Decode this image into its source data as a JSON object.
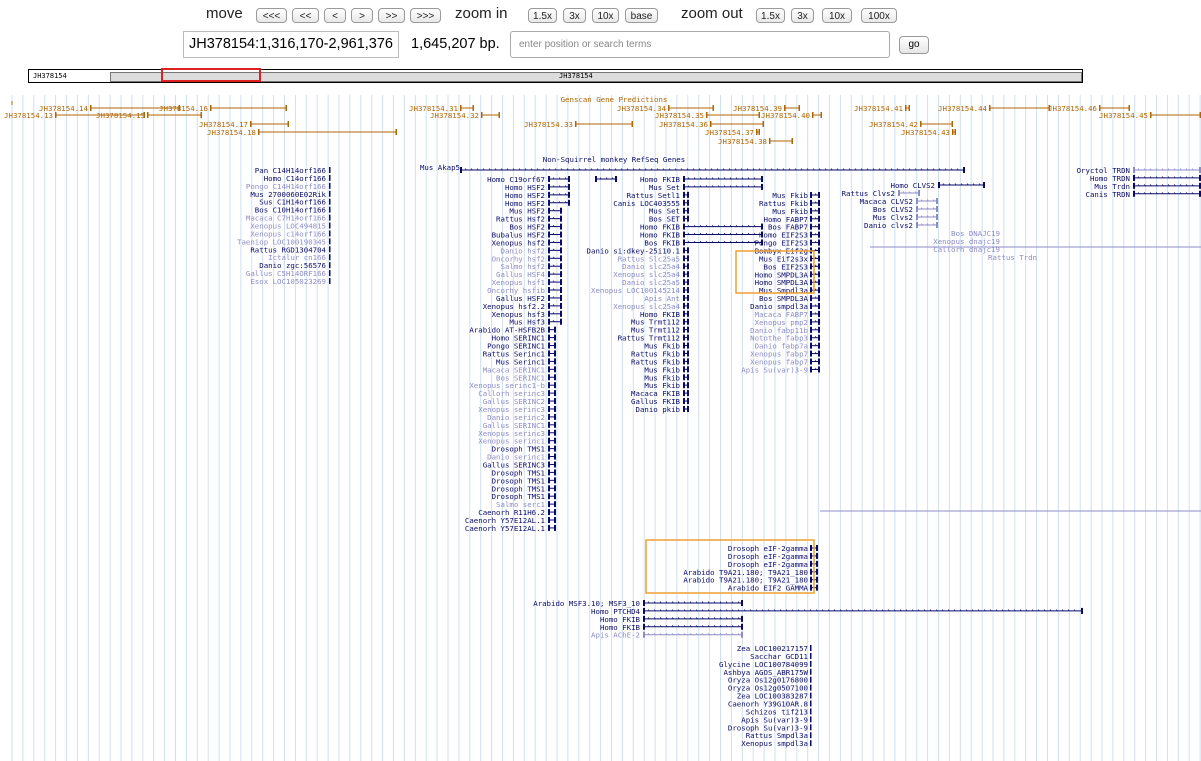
{
  "nav": {
    "move_label": "move",
    "move_buttons": [
      "<<<",
      "<<",
      "<",
      ">",
      ">>",
      ">>>"
    ],
    "zoom_in_label": "zoom in",
    "zoom_in_buttons": [
      "1.5x",
      "3x",
      "10x",
      "base"
    ],
    "zoom_out_label": "zoom out",
    "zoom_out_buttons": [
      "1.5x",
      "3x",
      "10x",
      "100x"
    ]
  },
  "position": {
    "value": "JH378154:1,316,170-2,961,376",
    "size": "1,645,207 bp.",
    "search_placeholder": "enter position or search terms",
    "go_label": "go"
  },
  "ideogram": {
    "chrom": "JH378154",
    "center_label": "JH378154"
  },
  "colors": {
    "contig": "#b26400",
    "gene": "#0a0a6a",
    "faded": "#8c8cc8",
    "grid": "#cfe0f2",
    "highlight": "#f0a030"
  },
  "tracks": {
    "contig_labels": [
      "JH378154.14",
      "JH378154.13",
      "JH378154.16",
      "JH378154.15",
      "JH378154.17",
      "JH378154.18",
      "JH378154.31",
      "JH378154.32",
      "JH378154.33",
      "JH378154.34",
      "JH378154.35",
      "JH378154.39",
      "JH378154.40",
      "JH378154.36",
      "JH378154.37",
      "JH378154.38",
      "JH378154.41",
      "JH378154.44",
      "JH378154.42",
      "JH378154.43",
      "JH378154.46",
      "JH378154.45"
    ],
    "genscan_title": "Genscan Gene Predictions",
    "refseq_title": "Non-Squirrel monkey RefSeq Genes",
    "left_genes": [
      "Pan C14H14orf166",
      "Homo C14orf166",
      "Pongo C14H14orf166",
      "Mus 2700060E02Rik",
      "Sus C1H14orf166",
      "Bos C10H14orf166",
      "Macaca C7H14orf166",
      "Xenopus LOC494815",
      "Xenopus c14orf166",
      "Taeniop LOC100190345",
      "Rattus RGD1304704",
      "Ictalur cn166",
      "Danio zgc:56576",
      "Gallus C5H14ORF166",
      "Esox LOC105023269"
    ],
    "center_genes": [
      "Homo C19orf67",
      "Homo HSF2",
      "Homo HSF2",
      "Homo HSF2",
      "Mus HSF2",
      "Rattus Hsf2",
      "Bos HSF2",
      "Bubalus HSF2",
      "Xenopus hsf2",
      "Danio hsf2",
      "Oncorhy hsf2",
      "Salmo hsf2",
      "Gallus HSF4",
      "Xenopus hsf1",
      "Oncorhy hsfib",
      "Gallus HSF2",
      "Xenopus hsf2.2",
      "Xenopus hsf3",
      "Mus Hsf3",
      "Arabido AT-HSFB2B",
      "Homo SERINC1",
      "Pongo SERINC1",
      "Rattus Serinc1",
      "Mus Serinc1",
      "Macaca SERINC1",
      "Bos SERINC1",
      "Xenopus serinc1-b",
      "Callorh serinc3",
      "Gallus SERINC2",
      "Xenopus serinc3",
      "Danio serinc2",
      "Gallus SERINC1",
      "Xenopus serinc3",
      "Xenopus serinc1",
      "Drosoph TMS1",
      "Danio serinc1",
      "Gallus SERINC3",
      "Drosoph TMS1",
      "Drosoph TMS1",
      "Drosoph TMS1",
      "Drosoph TMS1",
      "Salmo serc1",
      "Caenorh R11H6.2",
      "Caenorh Y57E12AL.1",
      "Caenorh Y57E12AL.1"
    ],
    "right_labels_a": [
      "Homo FKIB",
      "Mus Set",
      "Rattus Setl1",
      "Canis LOC403555",
      "Mus Set",
      "Bos SET",
      "Homo FKIB",
      "Homo FKIB",
      "Bos FKIB",
      "Danio si:dkey-25i10.1",
      "Rattus Slc25a5",
      "Danio slc25a4",
      "Xenopus slc25a4",
      "Danio slc25a5",
      "Xenopus LOC100145214",
      "Apis Ant",
      "Xenopus slc25a4",
      "Homo FKIB",
      "Mus Trmt112",
      "Mus Trmt112",
      "Rattus Trmt112",
      "Mus Fkib",
      "Rattus Fkib",
      "Rattus Fkib",
      "Mus Fkib",
      "Mus Fkib",
      "Mus Fkib",
      "Macaca FKIB",
      "Gallus FKIB",
      "Danio pkib"
    ],
    "right_labels_b": [
      "Mus Fkib",
      "Rattus Fkib",
      "Mus Fkib",
      "Homo FABP7",
      "Bos FABP7",
      "Homo EIF2S3",
      "Pongo EIF2S3",
      "Bombyx Eif2g",
      "Mus Eif2s3x",
      "Bos EIF2S3",
      "Homo SMPDL3A",
      "Homo SMPDL3A",
      "Mus Smpdl3a",
      "Bos SMPDL3A",
      "Danio smpdl3a",
      "Macaca FABP7",
      "Xenopus pmp2",
      "Danio fabp11b",
      "Notothe fabp3",
      "Danio fabp7a",
      "Xenopus fabp7",
      "Xenopus fabp7",
      "Apis Su(var)3-9"
    ],
    "orange_box_genes": [
      "Drosoph eIF-2gamma",
      "Drosoph eIF-2gamma",
      "Drosoph eIF-2gamma",
      "Arabido T9A21.180; T9A21_180",
      "Arabido T9A21.180; T9A21_180",
      "Arabido EIF2 GAMMA"
    ],
    "mid_lower": [
      "Arabido MSF3.10; MSF3_10",
      "Homo PTCHD4",
      "Homo FKIB",
      "Homo FKIB",
      "Apis AChE-2"
    ],
    "bottom_genes": [
      "Zea LOC100217157",
      "Sacchar GCD11",
      "Glycine LOC100784099",
      "Ashbya AGOS_ABR175W",
      "Oryza Os12g0176800",
      "Oryza Os12g0507100",
      "Zea LOC100383287",
      "Caenorh Y39G10AR.8",
      "Schizos tif213",
      "Apis Su(var)3-9",
      "Drosoph Su(var)3-9",
      "Rattus Smpdl3a",
      "Xenopus smpdl3a"
    ],
    "far_right_a": [
      "Mus Akap5",
      "Homo CLVS2",
      "Rattus Clvs2",
      "Macaca CLVS2",
      "Bos CLVS2",
      "Mus Clvs2",
      "Danio clvs2",
      "Bos DNAJC19",
      "Xenopus dnajc19",
      "Callorh dnajc19",
      "Rattus Trdn"
    ],
    "far_right_b": [
      "Oryctol TRDN",
      "Homo TRDN",
      "Mus Trdn",
      "Canis TRDN"
    ]
  }
}
